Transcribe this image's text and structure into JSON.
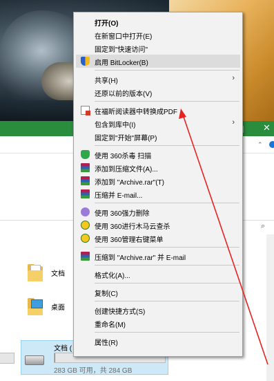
{
  "window": {
    "max_glyph": "口",
    "close_glyph": "✕",
    "ribbon_chevron": "⌃",
    "search_glyph": "⌕"
  },
  "explorer": {
    "folders": [
      {
        "label": "文档",
        "icon": "documents-folder-icon"
      },
      {
        "label": "桌面",
        "icon": "desktop-folder-icon"
      }
    ],
    "drive": {
      "name": "文档 (",
      "size_text": "283 GB 可用，共 284 GB",
      "used_fraction": 0.004
    }
  },
  "context_menu": {
    "items": [
      {
        "label": "打开(O)",
        "bold": true,
        "icon": ""
      },
      {
        "label": "在新窗口中打开(E)",
        "icon": ""
      },
      {
        "label": "固定到\"快速访问\"",
        "icon": ""
      },
      {
        "label": "启用 BitLocker(B)",
        "icon": "shield-icon",
        "hover": true
      },
      {
        "sep": true
      },
      {
        "label": "共享(H)",
        "icon": "",
        "submenu": true
      },
      {
        "label": "还原以前的版本(V)",
        "icon": ""
      },
      {
        "sep": true
      },
      {
        "label": "在福昕阅读器中转换成PDF",
        "icon": "pdf-convert-icon"
      },
      {
        "label": "包含到库中(I)",
        "icon": "",
        "submenu": true
      },
      {
        "label": "固定到\"开始\"屏幕(P)",
        "icon": ""
      },
      {
        "sep": true
      },
      {
        "label": "使用 360杀毒 扫描",
        "icon": "antivirus-360-icon"
      },
      {
        "label": "添加到压缩文件(A)...",
        "icon": "winrar-icon"
      },
      {
        "label": "添加到 \"Archive.rar\"(T)",
        "icon": "winrar-icon"
      },
      {
        "label": "压缩并 E-mail...",
        "icon": "winrar-icon"
      },
      {
        "sep": true
      },
      {
        "label": "使用 360强力删除",
        "icon": "force-delete-360-icon"
      },
      {
        "label": "使用 360进行木马云查杀",
        "icon": "trojan-scan-360-icon"
      },
      {
        "label": "使用 360管理右键菜单",
        "icon": "menu-manager-360-icon"
      },
      {
        "sep": true
      },
      {
        "label": "压缩到 \"Archive.rar\" 并 E-mail",
        "icon": "winrar-icon"
      },
      {
        "sep": true
      },
      {
        "label": "格式化(A)...",
        "icon": ""
      },
      {
        "sep": true
      },
      {
        "label": "复制(C)",
        "icon": ""
      },
      {
        "sep": true
      },
      {
        "label": "创建快捷方式(S)",
        "icon": ""
      },
      {
        "label": "重命名(M)",
        "icon": ""
      },
      {
        "sep": true
      },
      {
        "label": "属性(R)",
        "icon": ""
      }
    ],
    "submenu_glyph": "›"
  },
  "annotation": {
    "color": "#e8231f"
  }
}
